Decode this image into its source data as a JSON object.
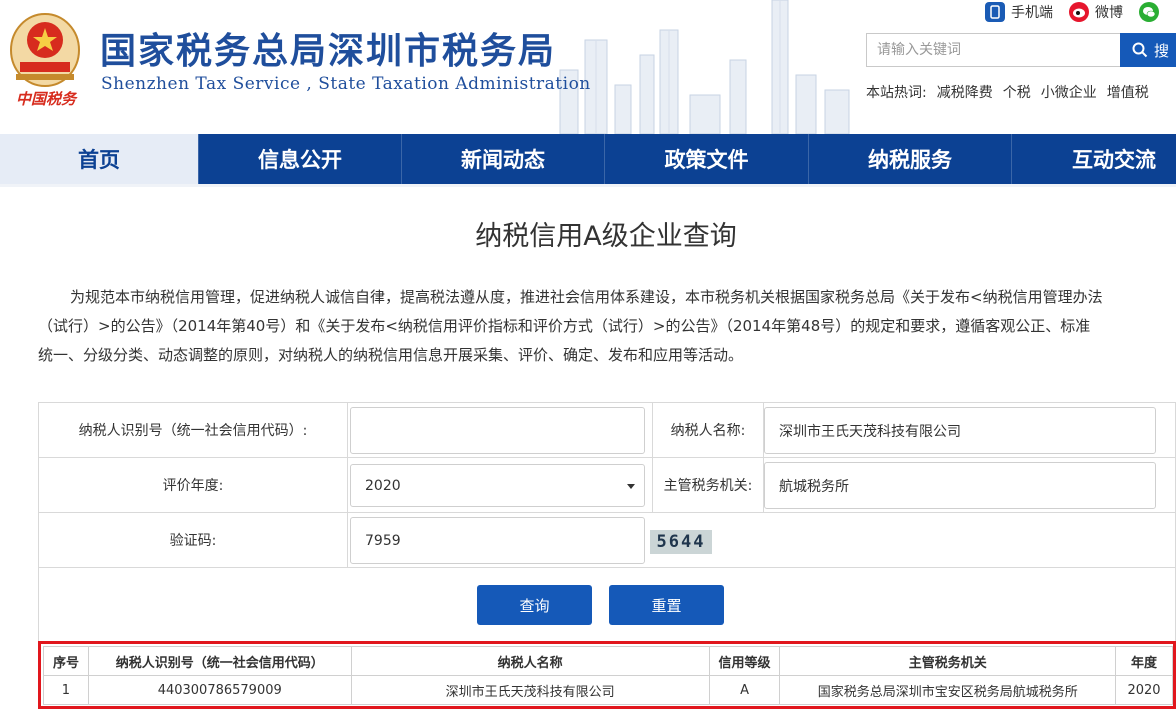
{
  "colors": {
    "brand_blue": "#1f4e9c",
    "nav_blue": "#0c4193",
    "button_blue": "#1559b8",
    "highlight_red": "#e1171d"
  },
  "header": {
    "title_cn": "国家税务总局深圳市税务局",
    "title_en": "Shenzhen  Tax  Service , State Taxation  Administration",
    "emblem_text": "中国税务",
    "top_links": [
      {
        "label": "手机端",
        "icon": "mobile-icon"
      },
      {
        "label": "微博",
        "icon": "weibo-icon"
      },
      {
        "label": "",
        "icon": "wechat-icon"
      }
    ],
    "search": {
      "placeholder": "请输入关键词",
      "button_label": "搜"
    },
    "hot": {
      "label": "本站热词:",
      "items": [
        "减税降费",
        "个税",
        "小微企业",
        "增值税"
      ]
    }
  },
  "nav": {
    "items": [
      {
        "label": "首页",
        "active": true
      },
      {
        "label": "信息公开"
      },
      {
        "label": "新闻动态"
      },
      {
        "label": "政策文件"
      },
      {
        "label": "纳税服务"
      },
      {
        "label": "互动交流"
      }
    ]
  },
  "main": {
    "title": "纳税信用A级企业查询",
    "intro_lines": [
      "为规范本市纳税信用管理，促进纳税人诚信自律，提高税法遵从度，推进社会信用体系建设，本市税务机关根据国家税务总局《关于发布<纳税信用管理办法",
      "（试行）>的公告》（2014年第40号）和《关于发布<纳税信用评价指标和评价方式（试行）>的公告》（2014年第48号）的规定和要求，遵循客观公正、标准",
      "统一、分级分类、动态调整的原则，对纳税人的纳税信用信息开展采集、评价、确定、发布和应用等活动。"
    ]
  },
  "form": {
    "taxpayer_id_label": "纳税人识别号（统一社会信用代码）:",
    "taxpayer_id_value": "",
    "taxpayer_name_label": "纳税人名称:",
    "taxpayer_name_value": "深圳市王氏天茂科技有限公司",
    "year_label": "评价年度:",
    "year_value": "2020",
    "authority_label": "主管税务机关:",
    "authority_value": "航城税务所",
    "captcha_label": "验证码:",
    "captcha_value": "7959",
    "captcha_image_text": "5644",
    "query_button": "查询",
    "reset_button": "重置"
  },
  "results": {
    "headers": [
      "序号",
      "纳税人识别号（统一社会信用代码）",
      "纳税人名称",
      "信用等级",
      "主管税务机关",
      "年度"
    ],
    "rows": [
      [
        "1",
        "440300786579009",
        "深圳市王氏天茂科技有限公司",
        "A",
        "国家税务总局深圳市宝安区税务局航城税务所",
        "2020"
      ]
    ]
  }
}
